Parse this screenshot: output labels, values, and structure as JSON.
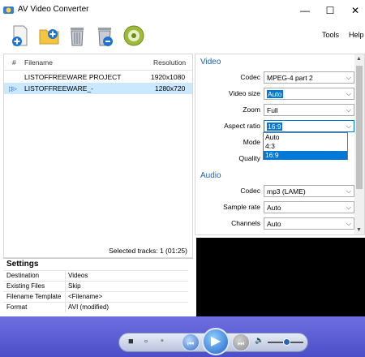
{
  "window": {
    "title": "AV Video Converter",
    "controls": {
      "minimize": "—",
      "maximize": "☐",
      "close": "✕"
    }
  },
  "toolbar": {
    "buttons": [
      {
        "name": "add-file-button",
        "icon": "add-file-icon"
      },
      {
        "name": "add-folder-button",
        "icon": "add-folder-icon"
      },
      {
        "name": "remove-button",
        "icon": "trash-icon"
      },
      {
        "name": "remove-all-button",
        "icon": "trash-all-icon"
      },
      {
        "name": "convert-button",
        "icon": "convert-disc-icon"
      }
    ],
    "menu": {
      "tools": "Tools",
      "help": "Help"
    }
  },
  "tracks": {
    "columns": {
      "index": "#",
      "filename": "Filename",
      "resolution": "Resolution"
    },
    "rows": [
      {
        "filename": "LISTOFFREEWARE PROJECT",
        "resolution": "1920x1080",
        "selected": false
      },
      {
        "filename": "LISTOFFREEWARE_-",
        "resolution": "1280x720",
        "selected": true
      }
    ],
    "play_marker": "▷▷",
    "status": "Selected tracks: 1 (01:25)"
  },
  "settings": {
    "title": "Settings",
    "rows": [
      {
        "key": "Destination",
        "value": "Videos"
      },
      {
        "key": "Existing Files",
        "value": "Skip"
      },
      {
        "key": "Filename Template",
        "value": "<Filename>"
      },
      {
        "key": "Format",
        "value": "AVI (modified)"
      }
    ]
  },
  "video": {
    "section": "Video",
    "codec_label": "Codec",
    "codec_value": "MPEG-4 part 2",
    "size_label": "Video size",
    "size_value": "Auto",
    "zoom_label": "Zoom",
    "zoom_value": "Full",
    "aspect_label": "Aspect ratio",
    "aspect_value": "16:9",
    "mode_label": "Mode",
    "quality_label": "Quality",
    "aspect_options": [
      "Auto",
      "4:3",
      "16:9"
    ],
    "aspect_selected": "16:9"
  },
  "audio": {
    "section": "Audio",
    "codec_label": "Codec",
    "codec_value": "mp3 (LAME)",
    "rate_label": "Sample rate",
    "rate_value": "Auto",
    "channels_label": "Channels",
    "channels_value": "Auto"
  },
  "player": {
    "stop": "■",
    "prev": "⏮",
    "play": "▶",
    "next": "⏭",
    "volume_icon": "🔈",
    "volume_level": 0.55
  },
  "colors": {
    "accent": "#0078d7",
    "player_bg": "#5a5cd4",
    "section_text": "#1c5fb5"
  }
}
